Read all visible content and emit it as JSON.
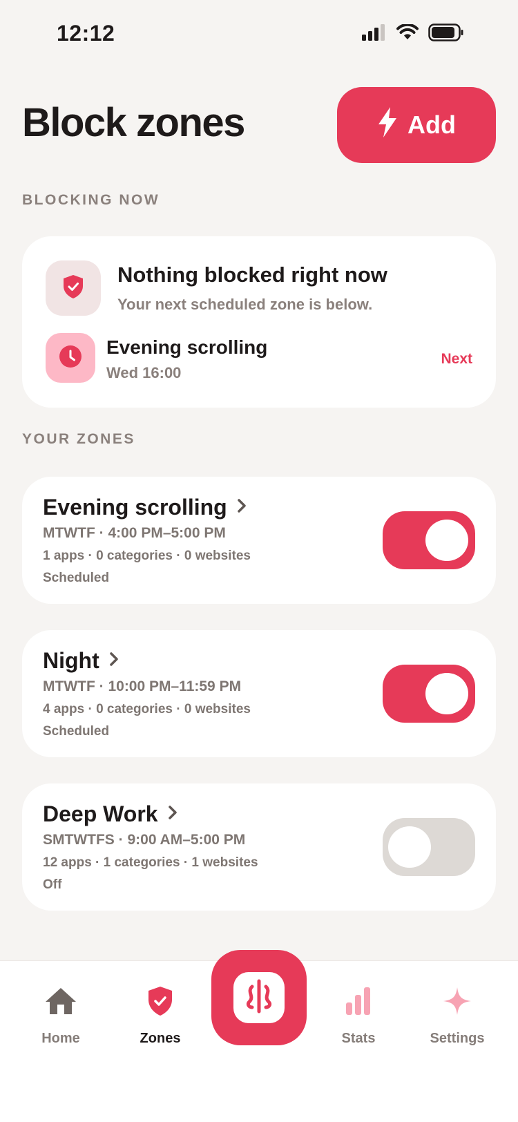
{
  "status_bar": {
    "time": "12:12"
  },
  "header": {
    "title": "Block zones",
    "add_label": "Add"
  },
  "blocking_now": {
    "section_label": "BLOCKING NOW",
    "title": "Nothing blocked right now",
    "subtitle": "Your next scheduled zone is below.",
    "next_zone": {
      "name": "Evening scrolling",
      "time": "Wed 16:00",
      "badge": "Next"
    }
  },
  "your_zones": {
    "section_label": "YOUR ZONES",
    "zones": [
      {
        "name": "Evening scrolling",
        "schedule": "MTWTF · 4:00 PM–5:00 PM",
        "counts": "1 apps · 0 categories · 0 websites",
        "status": "Scheduled",
        "enabled": true
      },
      {
        "name": "Night",
        "schedule": "MTWTF · 10:00 PM–11:59 PM",
        "counts": "4 apps · 0 categories · 0 websites",
        "status": "Scheduled",
        "enabled": true
      },
      {
        "name": "Deep Work",
        "schedule": "SMTWTFS · 9:00 AM–5:00 PM",
        "counts": "12 apps · 1 categories · 1 websites",
        "status": "Off",
        "enabled": false
      }
    ]
  },
  "tab_bar": {
    "items": [
      {
        "label": "Home",
        "icon": "home-icon"
      },
      {
        "label": "Zones",
        "icon": "shield-icon",
        "active": true
      },
      {
        "label": "",
        "icon": "app-logo-icon"
      },
      {
        "label": "Stats",
        "icon": "bar-chart-icon"
      },
      {
        "label": "Settings",
        "icon": "sparkle-icon"
      }
    ]
  },
  "colors": {
    "accent": "#E63A58",
    "background": "#F6F4F2",
    "muted_text": "#8A807C",
    "toggle_off": "#DDD9D5"
  }
}
